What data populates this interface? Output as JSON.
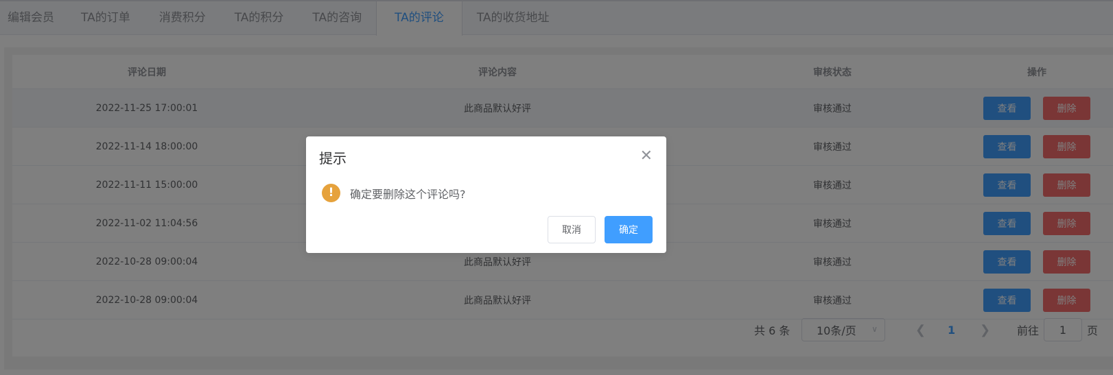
{
  "tabs": [
    {
      "label": "编辑会员"
    },
    {
      "label": "TA的订单"
    },
    {
      "label": "消费积分"
    },
    {
      "label": "TA的积分"
    },
    {
      "label": "TA的咨询"
    },
    {
      "label": "TA的评论"
    },
    {
      "label": "TA的收货地址"
    }
  ],
  "active_tab": "TA的评论",
  "table": {
    "headers": [
      "评论日期",
      "评论内容",
      "审核状态",
      "操作"
    ],
    "rows": [
      {
        "date": "2022-11-25 17:00:01",
        "content": "此商品默认好评",
        "status": "审核通过"
      },
      {
        "date": "2022-11-14 18:00:00",
        "content": "",
        "status": "审核通过"
      },
      {
        "date": "2022-11-11 15:00:00",
        "content": "",
        "status": "审核通过"
      },
      {
        "date": "2022-11-02 11:04:56",
        "content": "",
        "status": "审核通过"
      },
      {
        "date": "2022-10-28 09:00:04",
        "content": "此商品默认好评",
        "status": "审核通过"
      },
      {
        "date": "2022-10-28 09:00:04",
        "content": "此商品默认好评",
        "status": "审核通过"
      }
    ],
    "view_label": "查看",
    "delete_label": "删除"
  },
  "pagination": {
    "total": "共 6 条",
    "page_size": "10条/页",
    "current_page": "1",
    "goto_label": "前往",
    "goto_value": "1",
    "page_unit": "页"
  },
  "dialog": {
    "title": "提示",
    "message": "确定要删除这个评论吗?",
    "cancel_label": "取消",
    "confirm_label": "确定",
    "icon": "warning-icon"
  },
  "colors": {
    "primary": "#409eff",
    "danger": "#f56c6c",
    "warning": "#e6a23c"
  }
}
